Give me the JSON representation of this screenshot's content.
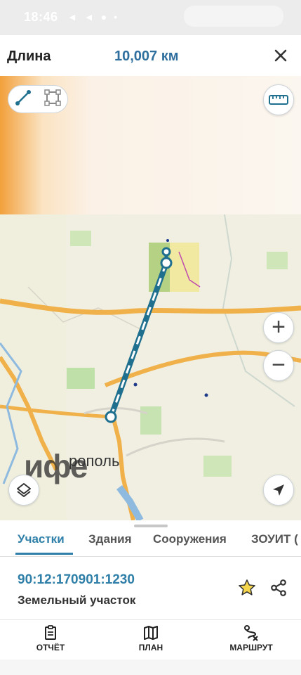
{
  "status_bar": {
    "time": "18:46",
    "icons": [
      "telegram-icon",
      "telegram-icon",
      "chat-icon",
      "dot-icon"
    ]
  },
  "header": {
    "title": "Длина",
    "value": "10,007 км",
    "close_icon": "close-icon"
  },
  "map": {
    "city_label_partial": "ифе",
    "city_label_suffix": "рополь",
    "controls": [
      "line-tool-icon",
      "polygon-tool-icon",
      "ruler-icon",
      "zoom-in-icon",
      "zoom-out-icon",
      "layers-icon",
      "locate-icon"
    ]
  },
  "tabs": [
    {
      "label": "Участки",
      "active": true
    },
    {
      "label": "Здания",
      "active": false
    },
    {
      "label": "Сооружения",
      "active": false
    },
    {
      "label": "ЗОУИТ (",
      "active": false
    }
  ],
  "parcel": {
    "cadastral_number": "90:12:170901:1230",
    "type": "Земельный участок"
  },
  "bottom_nav": [
    {
      "label": "ОТЧЁТ",
      "icon": "report-icon"
    },
    {
      "label": "ПЛАН",
      "icon": "map-icon"
    },
    {
      "label": "МАРШРУТ",
      "icon": "route-icon"
    }
  ],
  "colors": {
    "accent": "#2f7fa8",
    "route_line": "#1f6f8f",
    "map_road": "#f0b14a"
  }
}
